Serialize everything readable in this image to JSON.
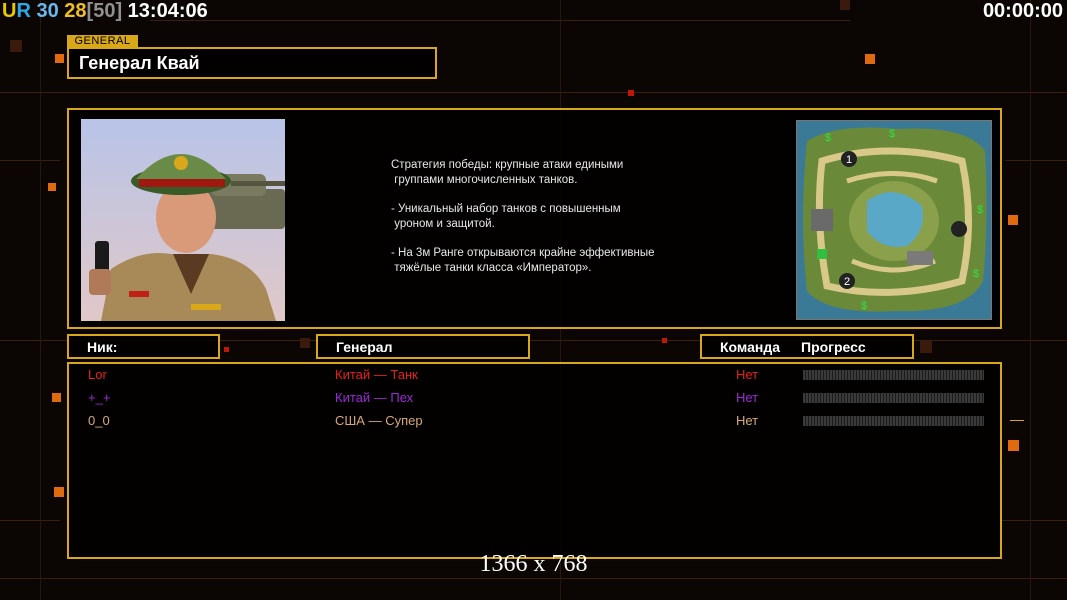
{
  "topbar": {
    "u": "U",
    "r": "R",
    "n1": "30",
    "n2": "28",
    "n3": "[50]",
    "clock": "13:04:06",
    "timer": "00:00:00"
  },
  "general_tag": "GENERAL",
  "title": "Генерал Квай",
  "description": {
    "p1_line1": "Стратегия победы: крупные атаки едиными",
    "p1_line2": "группами многочисленных танков.",
    "p2_line1": "- Уникальный набор танков с повышенным",
    "p2_line2": "уроном и защитой.",
    "p3_line1": "- На 3м Ранге открываются крайне эффективные",
    "p3_line2": "тяжёлые танки класса «Император»."
  },
  "headers": {
    "nick": "Ник:",
    "general": "Генерал",
    "team": "Команда",
    "progress": "Прогресс"
  },
  "players": [
    {
      "nick": "Lor",
      "general": "Китай — Танк",
      "team": "Нет",
      "color": "#e8201a"
    },
    {
      "nick": "+_+",
      "general": "Китай — Пех",
      "team": "Нет",
      "color": "#9a2ad8"
    },
    {
      "nick": "0_0",
      "general": "США — Супер",
      "team": "Нет",
      "color": "#d8a878"
    }
  ],
  "resolution": "1366 x 768",
  "colors": {
    "frame": "#d8a81a",
    "accent_orange": "#e06a10"
  }
}
